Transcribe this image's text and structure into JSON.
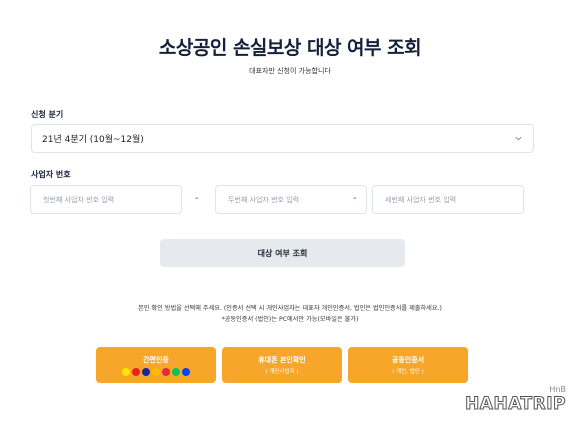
{
  "page": {
    "title": "소상공인 손실보상 대상 여부 조회",
    "subtitle": "대표자만 신청이 가능합니다"
  },
  "quarter": {
    "label": "신청 분기",
    "selected": "21년 4분기 (10월~12월)",
    "icon": "chevron-down-icon"
  },
  "business_number": {
    "label": "사업자 번호",
    "first_placeholder": "첫번째 사업자 번호 입력",
    "second_placeholder": "두번째 사업자 번호 입력",
    "third_placeholder": "세번째 사업자 번호 입력",
    "separator": "-"
  },
  "query_button": {
    "label": "대상 여부 조회"
  },
  "notice": {
    "line1": "본인 확인 방법을 선택해 주세요. (인증서 선택 시 개인사업자는 대표자 개인인증서, 법인은 법인인증서를 제출하세요.)",
    "line2": "*공동인증서 (법인)는 PC에서만 가능(모바일은 불가)"
  },
  "auth_buttons": [
    {
      "main": "간편인증",
      "sub": ""
    },
    {
      "main": "휴대폰 본인확인",
      "sub": "( 개인사업자 )"
    },
    {
      "main": "공동인증서",
      "sub": "( 개인, 법인 )"
    }
  ],
  "providers": [
    {
      "name": "kakao",
      "color": "#fee500"
    },
    {
      "name": "payco",
      "color": "#e8202a"
    },
    {
      "name": "samsung-pass",
      "color": "#1428a0"
    },
    {
      "name": "kb",
      "color": "#ffbc00"
    },
    {
      "name": "pass",
      "color": "#e5293b"
    },
    {
      "name": "naver",
      "color": "#03c75a"
    },
    {
      "name": "shinhan",
      "color": "#0046ff"
    }
  ],
  "watermark": {
    "small": "HnB",
    "logo": "HAHATRIP"
  },
  "colors": {
    "accent": "#f7a629",
    "button_gray": "#e6e9ee",
    "title": "#14203a"
  }
}
